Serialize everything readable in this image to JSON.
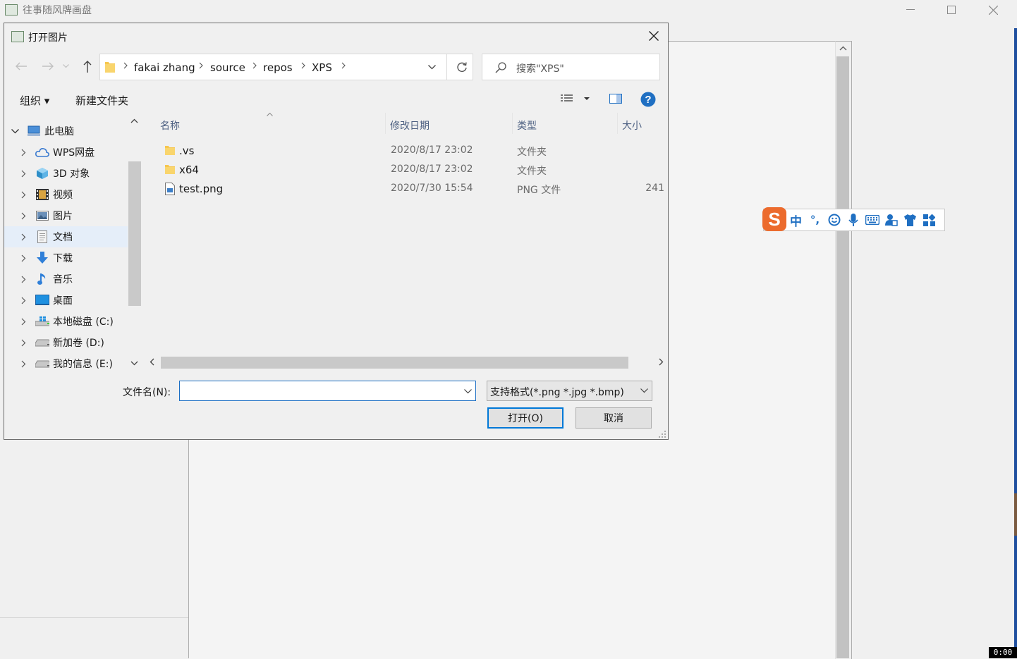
{
  "main_window": {
    "title": "往事随风牌画盘",
    "minimize_label": "—",
    "maximize_label": "☐",
    "close_label": "✕",
    "time_badge": "0:00"
  },
  "ime": {
    "logo": "S",
    "items": [
      "中",
      "°,",
      "☺",
      "mic",
      "keyboard",
      "person",
      "shirt",
      "grid"
    ],
    "labels": {
      "zh": "中",
      "punct": "°,"
    }
  },
  "dialog": {
    "title": "打开图片",
    "breadcrumb": [
      "fakai zhang",
      "source",
      "repos",
      "XPS"
    ],
    "search_placeholder": "搜索\"XPS\"",
    "organize_label": "组织 ▾",
    "new_folder_label": "新建文件夹",
    "nav_tree": [
      {
        "label": "此电脑",
        "icon": "computer-icon",
        "expanded": true
      },
      {
        "label": "WPS网盘",
        "icon": "cloud-icon"
      },
      {
        "label": "3D 对象",
        "icon": "3d-objects-icon"
      },
      {
        "label": "视频",
        "icon": "video-icon"
      },
      {
        "label": "图片",
        "icon": "pictures-icon"
      },
      {
        "label": "文档",
        "icon": "documents-icon",
        "selected": true
      },
      {
        "label": "下载",
        "icon": "download-icon"
      },
      {
        "label": "音乐",
        "icon": "music-icon"
      },
      {
        "label": "桌面",
        "icon": "desktop-icon"
      },
      {
        "label": "本地磁盘 (C:)",
        "icon": "drive-c-icon"
      },
      {
        "label": "新加卷 (D:)",
        "icon": "drive-icon"
      },
      {
        "label": "我的信息 (E:)",
        "icon": "drive-icon"
      }
    ],
    "columns": {
      "name": "名称",
      "date": "修改日期",
      "type": "类型",
      "size": "大小"
    },
    "files": [
      {
        "name": ".vs",
        "date": "2020/8/17 23:02",
        "type": "文件夹",
        "size": "",
        "icon": "folder-icon"
      },
      {
        "name": "x64",
        "date": "2020/8/17 23:02",
        "type": "文件夹",
        "size": "",
        "icon": "folder-icon"
      },
      {
        "name": "test.png",
        "date": "2020/7/30 15:54",
        "type": "PNG 文件",
        "size": "241",
        "icon": "image-file-icon"
      }
    ],
    "filename_label": "文件名(N):",
    "filename_value": "",
    "filter_value": "支持格式(*.png *.jpg *.bmp)",
    "open_label": "打开(O)",
    "cancel_label": "取消"
  },
  "colors": {
    "accent": "#0078d7",
    "folder": "#f6c64e",
    "ime_brand": "#ec6b2d",
    "ime_icon": "#1f6fc2",
    "help": "#1f6fc2"
  }
}
